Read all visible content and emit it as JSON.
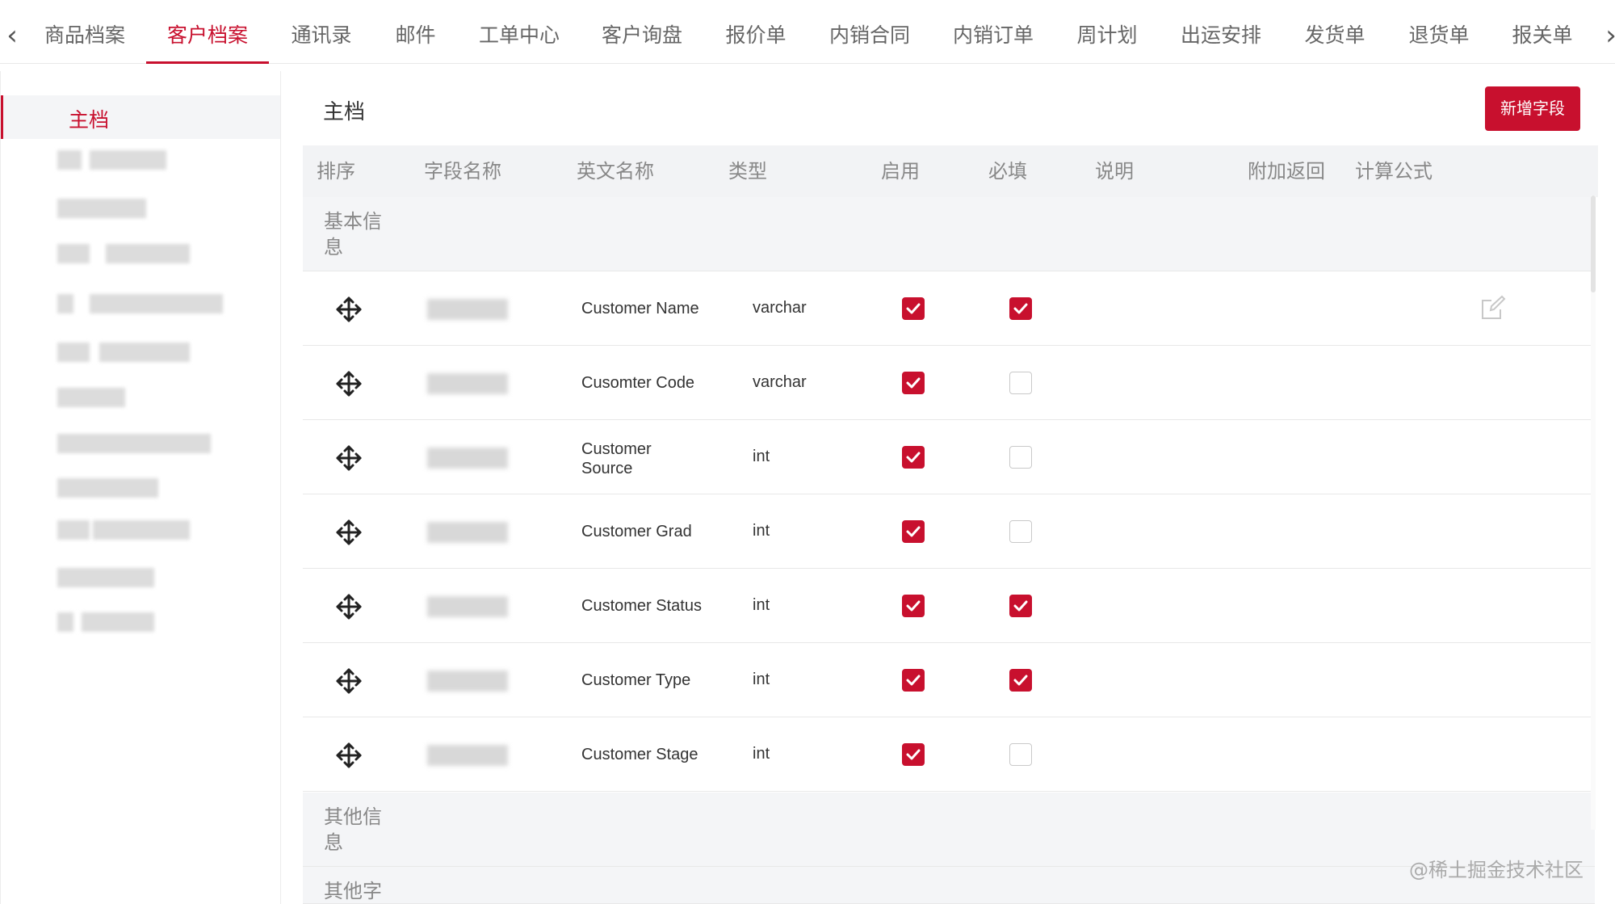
{
  "tabs": [
    {
      "label": "商品档案",
      "active": false
    },
    {
      "label": "客户档案",
      "active": true
    },
    {
      "label": "通讯录",
      "active": false
    },
    {
      "label": "邮件",
      "active": false
    },
    {
      "label": "工单中心",
      "active": false
    },
    {
      "label": "客户询盘",
      "active": false
    },
    {
      "label": "报价单",
      "active": false
    },
    {
      "label": "内销合同",
      "active": false
    },
    {
      "label": "内销订单",
      "active": false
    },
    {
      "label": "周计划",
      "active": false
    },
    {
      "label": "出运安排",
      "active": false
    },
    {
      "label": "发货单",
      "active": false
    },
    {
      "label": "退货单",
      "active": false
    },
    {
      "label": "报关单",
      "active": false
    }
  ],
  "nav": {
    "prev_icon": "chevron-left-icon",
    "next_icon": "chevron-right-icon"
  },
  "sidebar": {
    "active_label": "主档"
  },
  "main": {
    "title": "主档",
    "add_button_label": "新增字段"
  },
  "table": {
    "headers": {
      "order": "排序",
      "field_name": "字段名称",
      "english_name": "英文名称",
      "type": "类型",
      "enabled": "启用",
      "required": "必填",
      "description": "说明",
      "extra_return": "附加返回",
      "formula": "计算公式"
    },
    "groups": {
      "basic": "基本信息",
      "other_info": "其他信息",
      "other_fields": "其他字"
    },
    "rows": [
      {
        "english_name": "Customer Name",
        "type": "varchar",
        "enabled": true,
        "required": true
      },
      {
        "english_name": "Cusomter Code",
        "type": "varchar",
        "enabled": true,
        "required": false
      },
      {
        "english_name": "Customer Source",
        "type": "int",
        "enabled": true,
        "required": false
      },
      {
        "english_name": "Customer Grad",
        "type": "int",
        "enabled": true,
        "required": false
      },
      {
        "english_name": "Customer Status",
        "type": "int",
        "enabled": true,
        "required": true
      },
      {
        "english_name": "Customer Type",
        "type": "int",
        "enabled": true,
        "required": true
      },
      {
        "english_name": "Customer Stage",
        "type": "int",
        "enabled": true,
        "required": false
      }
    ]
  },
  "watermark": "@稀土掘金技术社区",
  "colors": {
    "accent": "#c8102e",
    "header_bg": "#f2f3f5",
    "group_bg": "#f4f5f7"
  }
}
